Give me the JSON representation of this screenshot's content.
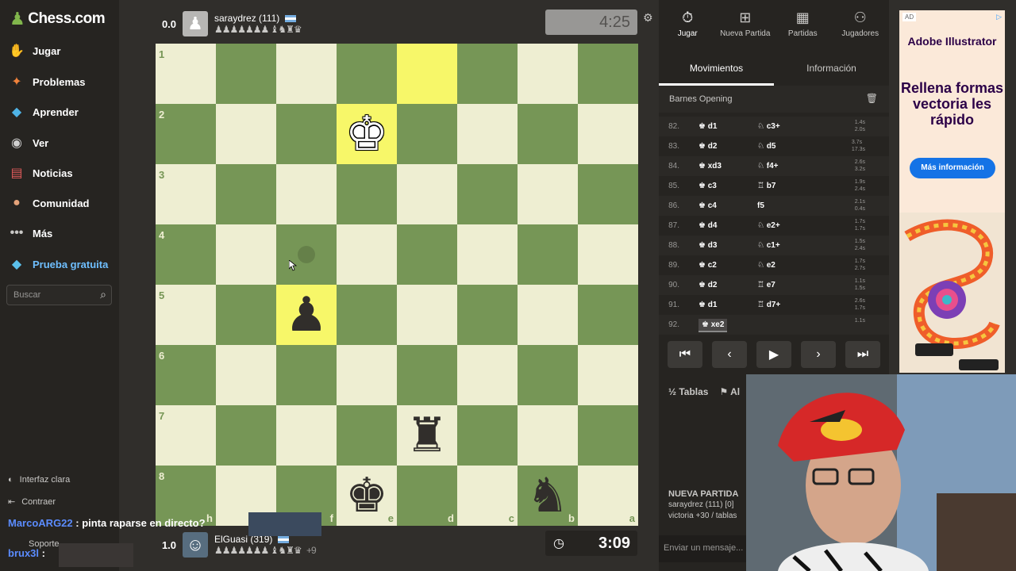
{
  "sidebar": {
    "logo": "Chess.com",
    "items": [
      {
        "label": "Jugar",
        "icon": "play-hand-icon"
      },
      {
        "label": "Problemas",
        "icon": "puzzle-icon"
      },
      {
        "label": "Aprender",
        "icon": "learn-icon"
      },
      {
        "label": "Ver",
        "icon": "binoculars-icon"
      },
      {
        "label": "Noticias",
        "icon": "news-icon"
      },
      {
        "label": "Comunidad",
        "icon": "community-icon"
      },
      {
        "label": "Más",
        "icon": "more-icon"
      }
    ],
    "premium": "Prueba gratuita",
    "search_placeholder": "Buscar",
    "bottom": [
      "Interfaz clara",
      "Contraer",
      "Soporte"
    ]
  },
  "top_player": {
    "score": "0.0",
    "name": "saraydrez (111)",
    "captured": "♟♟♟♟♟♟♟ ♝♞♜♛",
    "clock": "4:25"
  },
  "bottom_player": {
    "score": "1.0",
    "name": "ElGuasi (319)",
    "captured": "♟♟♟♟♟♟♟ ♝♞♜♛",
    "extra": "+9",
    "clock": "3:09"
  },
  "board": {
    "ranks": [
      "1",
      "2",
      "3",
      "4",
      "5",
      "6",
      "7",
      "8"
    ],
    "files": [
      "h",
      "g",
      "f",
      "e",
      "d",
      "c",
      "b",
      "a"
    ],
    "colors": {
      "light": "#eeeed2",
      "dark": "#769656",
      "highlight": "#f7f769"
    }
  },
  "panel": {
    "tabs": [
      "Jugar",
      "Nueva Partida",
      "Partidas",
      "Jugadores"
    ],
    "subtabs": [
      "Movimientos",
      "Información"
    ],
    "opening": "Barnes Opening",
    "moves": [
      {
        "n": "82.",
        "w": "♚ d1",
        "b": "♘ c3+",
        "t1": "1.4s",
        "t2": "2.0s"
      },
      {
        "n": "83.",
        "w": "♚ d2",
        "b": "♘ d5",
        "t1": "3.7s",
        "t2": "17.3s"
      },
      {
        "n": "84.",
        "w": "♚ xd3",
        "b": "♘ f4+",
        "t1": "2.6s",
        "t2": "3.2s"
      },
      {
        "n": "85.",
        "w": "♚ c3",
        "b": "♖ b7",
        "t1": "1.9s",
        "t2": "2.4s"
      },
      {
        "n": "86.",
        "w": "♚ c4",
        "b": "f5",
        "t1": "2.1s",
        "t2": "0.4s"
      },
      {
        "n": "87.",
        "w": "♚ d4",
        "b": "♘ e2+",
        "t1": "1.7s",
        "t2": "1.7s"
      },
      {
        "n": "88.",
        "w": "♚ d3",
        "b": "♘ c1+",
        "t1": "1.5s",
        "t2": "2.4s"
      },
      {
        "n": "89.",
        "w": "♚ c2",
        "b": "♘ e2",
        "t1": "1.7s",
        "t2": "2.7s"
      },
      {
        "n": "90.",
        "w": "♚ d2",
        "b": "♖ e7",
        "t1": "1.1s",
        "t2": "1.5s"
      },
      {
        "n": "91.",
        "w": "♚ d1",
        "b": "♖ d7+",
        "t1": "2.6s",
        "t2": "1.7s"
      },
      {
        "n": "92.",
        "w": "♚ xe2",
        "b": "",
        "t1": "1.1s",
        "t2": ""
      }
    ],
    "actions": [
      "Tablas",
      "Al"
    ],
    "newgame_title": "NUEVA PARTIDA",
    "newgame_line1": "saraydrez (111) [0]",
    "newgame_line2": "victoria +30 / tablas",
    "chat_placeholder": "Enviar un mensaje..."
  },
  "ad": {
    "tag": "AD",
    "brand": "Adobe Illustrator",
    "headline": "Rellena formas vectoria les rápido",
    "cta": "Más información"
  },
  "stream_chat": [
    {
      "user": "MarcoARG22",
      "msg": " : pinta raparse en directo?"
    },
    {
      "user": "brux3l",
      "msg": " :"
    }
  ]
}
